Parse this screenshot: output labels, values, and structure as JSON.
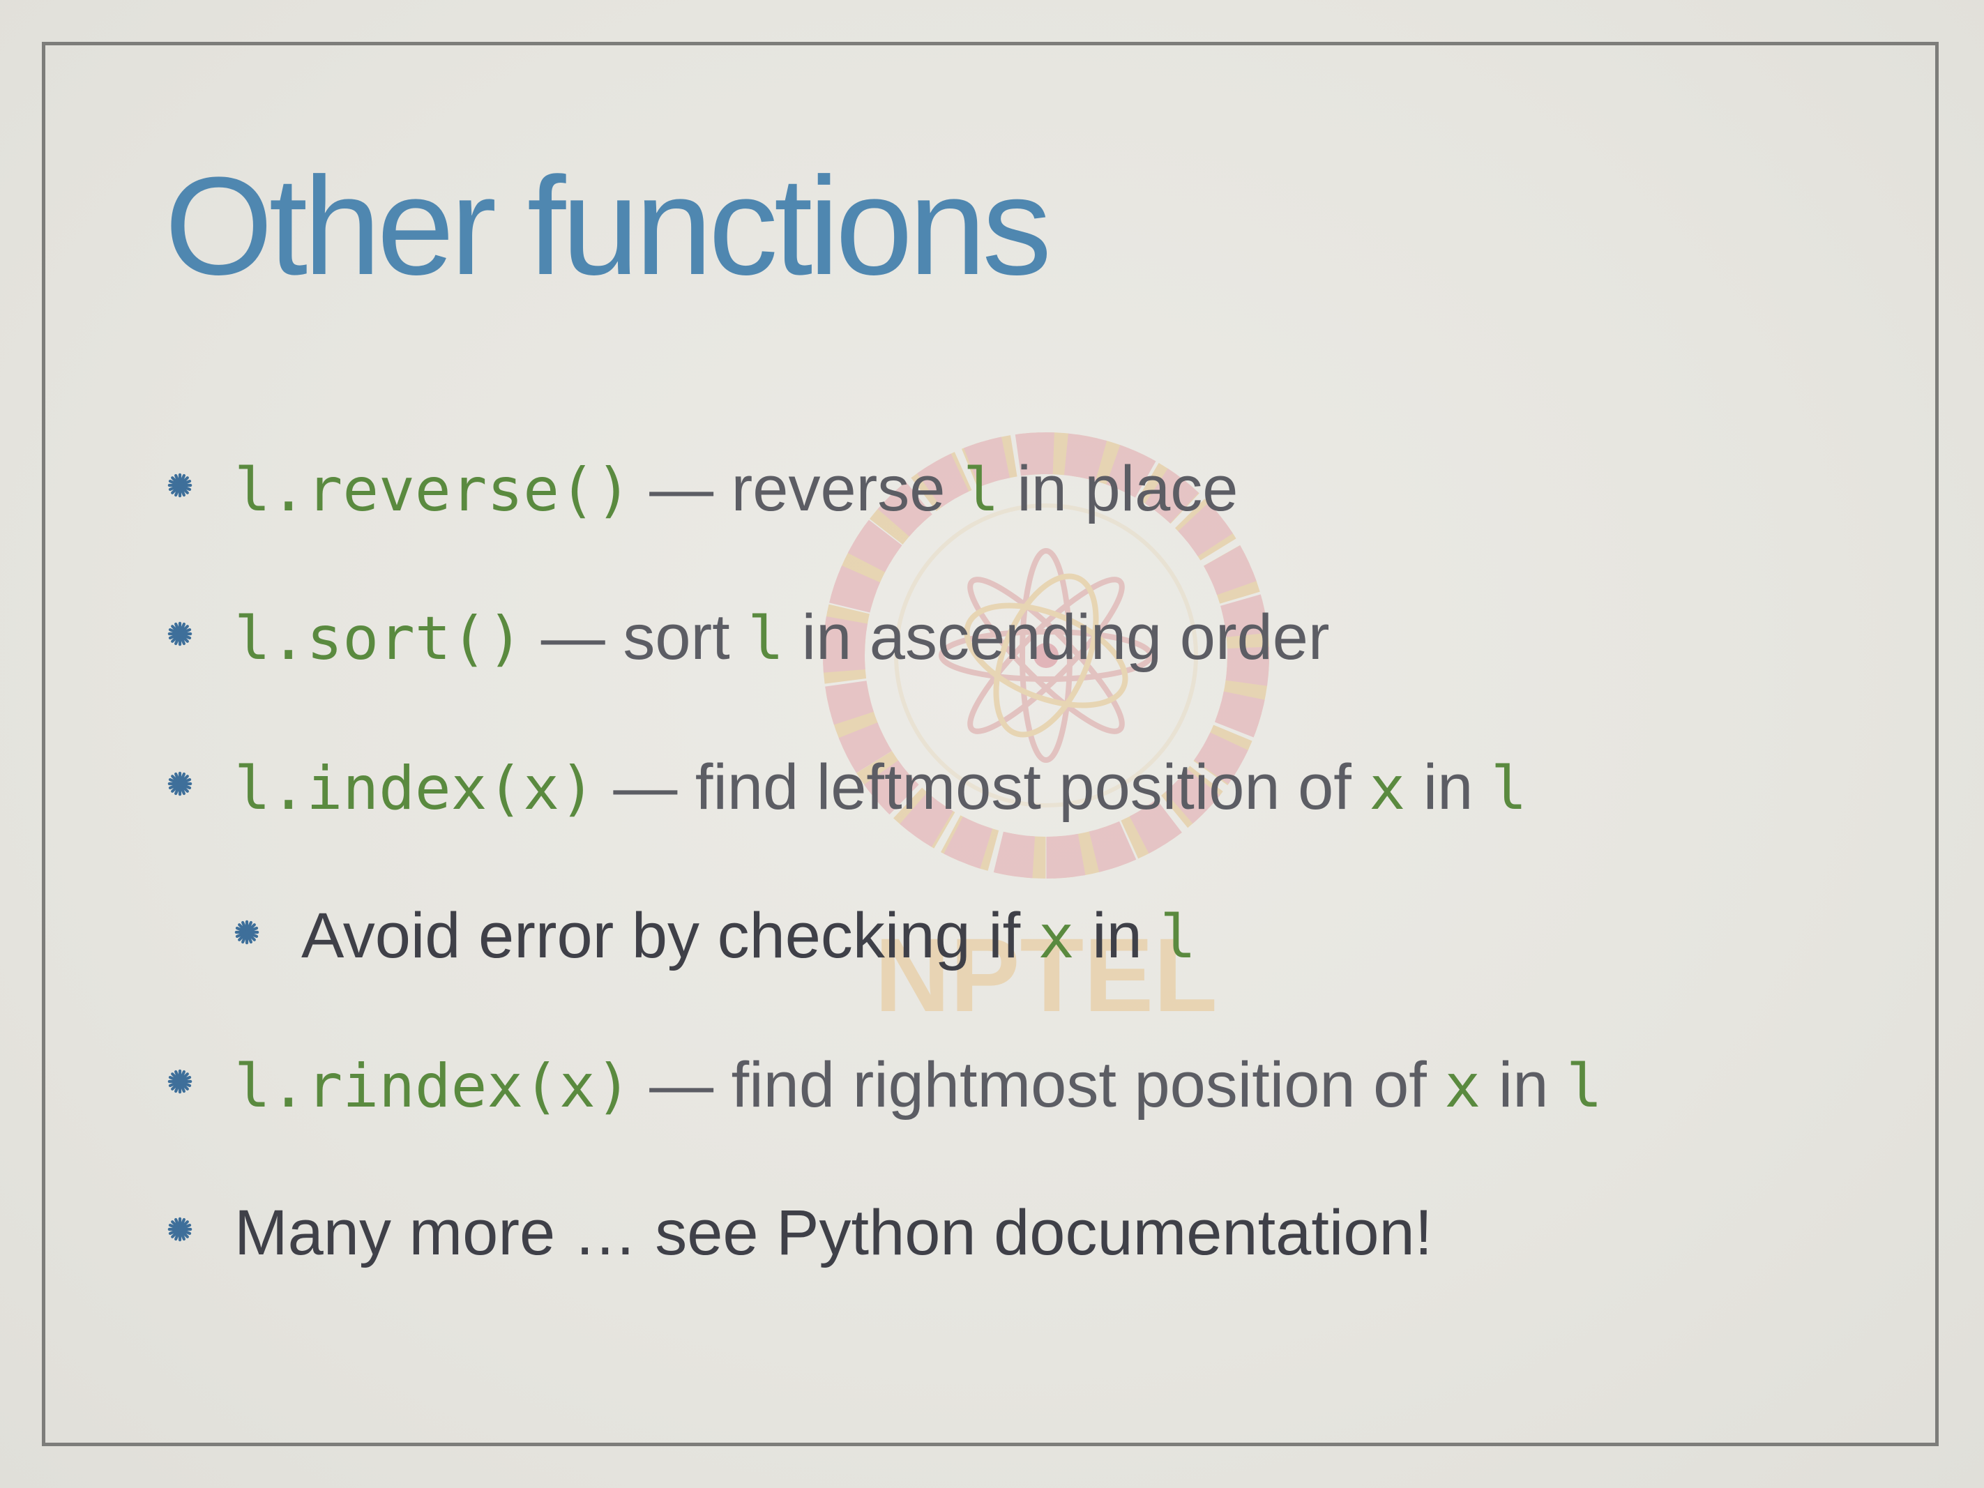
{
  "slide": {
    "title": "Other functions",
    "watermark_text": "NPTEL",
    "colors": {
      "background": "#e7e6e0",
      "frame": "#7d7d7a",
      "title": "#4f87b0",
      "code": "#5a8a3f",
      "text": "#5c5d64",
      "bullet_icon": "#3e6f9a"
    },
    "bullet_icon": "asterisk-bullet-icon",
    "bullets": [
      {
        "code": "l.reverse()",
        "dash": " — ",
        "text_a": "reverse ",
        "code_b": "l",
        "text_b": " in place"
      },
      {
        "code": "l.sort()",
        "dash": " — ",
        "text_a": "sort ",
        "code_b": "l",
        "text_b": " in ascending order"
      },
      {
        "code": "l.index(x)",
        "dash": " — ",
        "text_a": "find leftmost position of ",
        "code_b": "x",
        "text_b": " in ",
        "code_c": "l"
      },
      {
        "text_a": "Avoid error by checking if ",
        "code_b": "x",
        "text_b": " in ",
        "code_c": "l"
      },
      {
        "code": "l.rindex(x)",
        "dash": " — ",
        "text_a": "find rightmost position of ",
        "code_b": "x",
        "text_b": " in ",
        "code_c": "l"
      },
      {
        "text_a": "Many more … see Python documentation!"
      }
    ]
  }
}
